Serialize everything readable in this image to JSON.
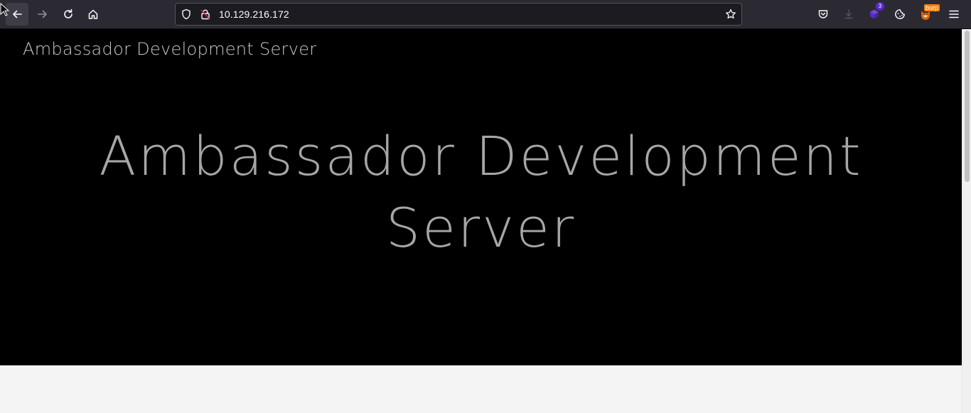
{
  "browser": {
    "url": "10.129.216.172",
    "extension_badge_count": "3",
    "burp_label": "burp"
  },
  "icons": {
    "back": "back-arrow-icon",
    "forward": "forward-arrow-icon",
    "reload": "reload-icon",
    "home": "home-icon",
    "shield": "tracking-protection-shield-icon",
    "lock": "insecure-lock-icon",
    "bookmark": "bookmark-star-icon",
    "pocket": "pocket-icon",
    "downloads": "downloads-icon",
    "extension": "extension-icon",
    "cookie": "cookie-icon",
    "burp": "burp-foxyproxy-icon",
    "menu": "hamburger-menu-icon"
  },
  "page": {
    "site_title": "Ambassador Development Server",
    "hero_heading": "Ambassador Development Server"
  },
  "colors": {
    "toolbar": "#2b2a33",
    "urlbar": "#1c1b22",
    "hero_bg": "#000000",
    "hero_text": "#a6a6a6",
    "page_bg": "#f4f4f4"
  }
}
